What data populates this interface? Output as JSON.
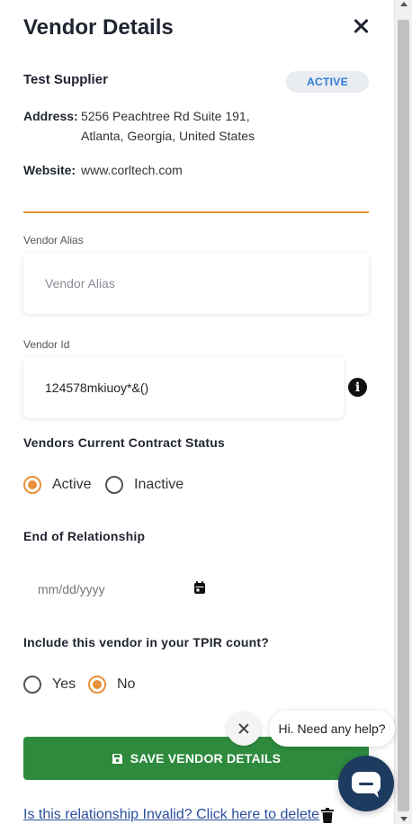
{
  "header": {
    "title": "Vendor Details"
  },
  "vendor": {
    "name": "Test Supplier",
    "status_badge": "ACTIVE",
    "address_label": "Address:",
    "address_line1": "5256 Peachtree Rd Suite 191,",
    "address_line2": "Atlanta, Georgia, United States",
    "website_label": "Website:",
    "website": "www.corltech.com"
  },
  "form": {
    "alias": {
      "label": "Vendor Alias",
      "placeholder": "Vendor Alias",
      "value": ""
    },
    "vendor_id": {
      "label": "Vendor Id",
      "value": "124578mkiuoy*&()"
    },
    "contract_status": {
      "title": "Vendors Current Contract Status",
      "options": [
        {
          "label": "Active",
          "selected": true
        },
        {
          "label": "Inactive",
          "selected": false
        }
      ]
    },
    "end_of_relationship": {
      "title": "End of Relationship",
      "placeholder": "mm/dd/yyyy"
    },
    "tpir": {
      "title": "Include this vendor in your TPIR count?",
      "options": [
        {
          "label": "Yes",
          "selected": false
        },
        {
          "label": "No",
          "selected": true
        }
      ]
    }
  },
  "actions": {
    "save_label": "SAVE VENDOR DETAILS",
    "delete_link": "Is this relationship Invalid? Click here to delete"
  },
  "chat": {
    "greeting": "Hi. Need any help?"
  },
  "colors": {
    "accent": "#e8913a",
    "save_button": "#2e8b3e",
    "badge_text": "#2e7bd6",
    "link": "#2b4f9b",
    "chat_launcher": "#1d3a5f"
  },
  "icons": [
    "close-icon",
    "info-icon",
    "calendar-icon",
    "save-icon",
    "trash-icon",
    "chat-icon"
  ]
}
